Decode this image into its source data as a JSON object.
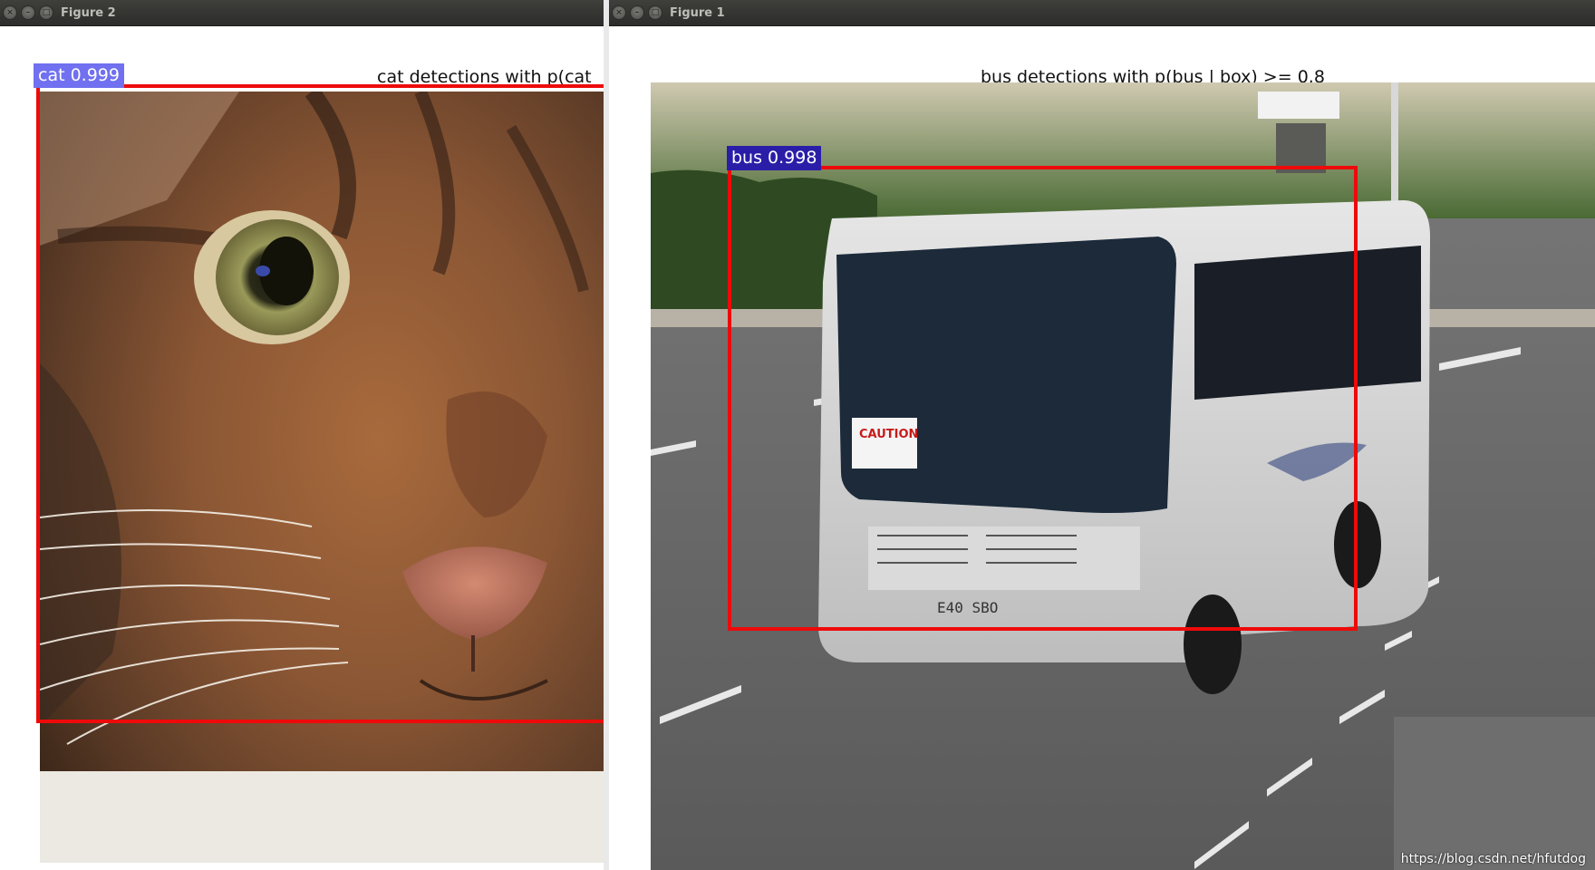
{
  "figure2": {
    "window_title": "Figure 2",
    "plot_title": "cat detections with p(cat",
    "detection": {
      "label": "cat 0.999",
      "label_bg": "#7070f0"
    }
  },
  "figure1": {
    "window_title": "Figure 1",
    "plot_title": "bus detections with p(bus | box) >= 0.8",
    "detection": {
      "label": "bus 0.998",
      "label_bg": "#2a1ea8"
    },
    "watermark": "https://blog.csdn.net/hfutdog"
  },
  "colors": {
    "box_stroke": "#ee0a0a",
    "titlebar": "#3a3a37"
  },
  "icons": [
    "close-icon",
    "minimize-icon",
    "maximize-icon"
  ]
}
